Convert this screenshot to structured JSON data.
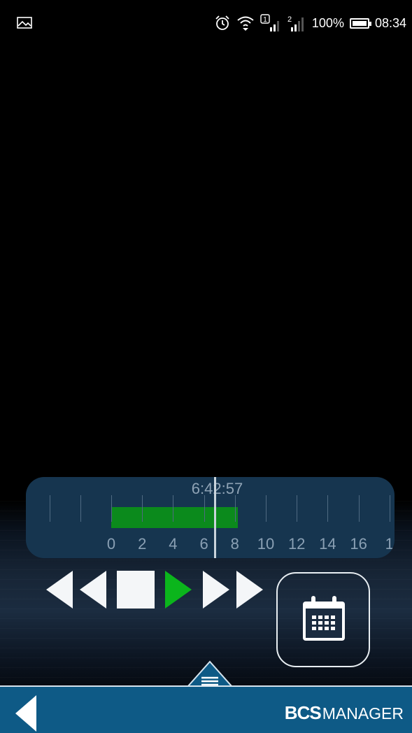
{
  "status_bar": {
    "battery_pct": "100%",
    "time": "08:34",
    "icons": [
      "gallery-icon",
      "alarm-icon",
      "wifi-icon",
      "sim1-signal-icon",
      "sim2-signal-icon",
      "battery-icon"
    ],
    "battery_level": 1.0
  },
  "timeline": {
    "current_time": "6:42:57",
    "tick_labels": [
      "0",
      "2",
      "4",
      "6",
      "8",
      "10",
      "12",
      "14",
      "16",
      "1"
    ],
    "recording_range": [
      0,
      8.2
    ],
    "cursor_value": 6.7,
    "colors": {
      "panel": "#16354f",
      "recording": "#0b8a1c"
    }
  },
  "controls": {
    "icons": [
      "rewind-icon",
      "stop-icon",
      "play-icon",
      "fast-forward-icon",
      "calendar-icon"
    ],
    "play_color": "#0bb51c"
  },
  "footer": {
    "brand_bold": "BCS",
    "brand_light": "MANAGER",
    "icons": [
      "back-icon",
      "menu-icon"
    ],
    "color": "#0e5a86"
  }
}
